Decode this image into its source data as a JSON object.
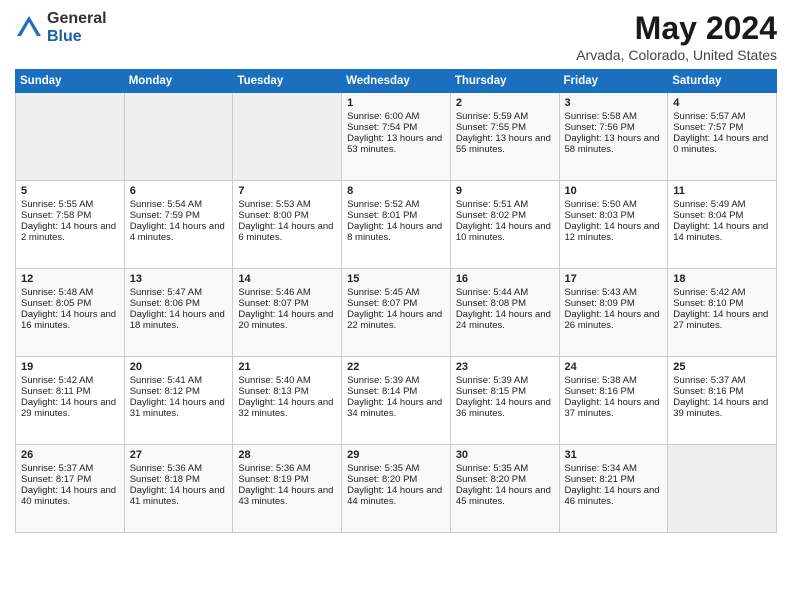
{
  "logo": {
    "general": "General",
    "blue": "Blue"
  },
  "header": {
    "title": "May 2024",
    "subtitle": "Arvada, Colorado, United States"
  },
  "days_of_week": [
    "Sunday",
    "Monday",
    "Tuesday",
    "Wednesday",
    "Thursday",
    "Friday",
    "Saturday"
  ],
  "weeks": [
    [
      {
        "day": "",
        "sunrise": "",
        "sunset": "",
        "daylight": "",
        "empty": true
      },
      {
        "day": "",
        "sunrise": "",
        "sunset": "",
        "daylight": "",
        "empty": true
      },
      {
        "day": "",
        "sunrise": "",
        "sunset": "",
        "daylight": "",
        "empty": true
      },
      {
        "day": "1",
        "sunrise": "Sunrise: 6:00 AM",
        "sunset": "Sunset: 7:54 PM",
        "daylight": "Daylight: 13 hours and 53 minutes.",
        "empty": false
      },
      {
        "day": "2",
        "sunrise": "Sunrise: 5:59 AM",
        "sunset": "Sunset: 7:55 PM",
        "daylight": "Daylight: 13 hours and 55 minutes.",
        "empty": false
      },
      {
        "day": "3",
        "sunrise": "Sunrise: 5:58 AM",
        "sunset": "Sunset: 7:56 PM",
        "daylight": "Daylight: 13 hours and 58 minutes.",
        "empty": false
      },
      {
        "day": "4",
        "sunrise": "Sunrise: 5:57 AM",
        "sunset": "Sunset: 7:57 PM",
        "daylight": "Daylight: 14 hours and 0 minutes.",
        "empty": false
      }
    ],
    [
      {
        "day": "5",
        "sunrise": "Sunrise: 5:55 AM",
        "sunset": "Sunset: 7:58 PM",
        "daylight": "Daylight: 14 hours and 2 minutes.",
        "empty": false
      },
      {
        "day": "6",
        "sunrise": "Sunrise: 5:54 AM",
        "sunset": "Sunset: 7:59 PM",
        "daylight": "Daylight: 14 hours and 4 minutes.",
        "empty": false
      },
      {
        "day": "7",
        "sunrise": "Sunrise: 5:53 AM",
        "sunset": "Sunset: 8:00 PM",
        "daylight": "Daylight: 14 hours and 6 minutes.",
        "empty": false
      },
      {
        "day": "8",
        "sunrise": "Sunrise: 5:52 AM",
        "sunset": "Sunset: 8:01 PM",
        "daylight": "Daylight: 14 hours and 8 minutes.",
        "empty": false
      },
      {
        "day": "9",
        "sunrise": "Sunrise: 5:51 AM",
        "sunset": "Sunset: 8:02 PM",
        "daylight": "Daylight: 14 hours and 10 minutes.",
        "empty": false
      },
      {
        "day": "10",
        "sunrise": "Sunrise: 5:50 AM",
        "sunset": "Sunset: 8:03 PM",
        "daylight": "Daylight: 14 hours and 12 minutes.",
        "empty": false
      },
      {
        "day": "11",
        "sunrise": "Sunrise: 5:49 AM",
        "sunset": "Sunset: 8:04 PM",
        "daylight": "Daylight: 14 hours and 14 minutes.",
        "empty": false
      }
    ],
    [
      {
        "day": "12",
        "sunrise": "Sunrise: 5:48 AM",
        "sunset": "Sunset: 8:05 PM",
        "daylight": "Daylight: 14 hours and 16 minutes.",
        "empty": false
      },
      {
        "day": "13",
        "sunrise": "Sunrise: 5:47 AM",
        "sunset": "Sunset: 8:06 PM",
        "daylight": "Daylight: 14 hours and 18 minutes.",
        "empty": false
      },
      {
        "day": "14",
        "sunrise": "Sunrise: 5:46 AM",
        "sunset": "Sunset: 8:07 PM",
        "daylight": "Daylight: 14 hours and 20 minutes.",
        "empty": false
      },
      {
        "day": "15",
        "sunrise": "Sunrise: 5:45 AM",
        "sunset": "Sunset: 8:07 PM",
        "daylight": "Daylight: 14 hours and 22 minutes.",
        "empty": false
      },
      {
        "day": "16",
        "sunrise": "Sunrise: 5:44 AM",
        "sunset": "Sunset: 8:08 PM",
        "daylight": "Daylight: 14 hours and 24 minutes.",
        "empty": false
      },
      {
        "day": "17",
        "sunrise": "Sunrise: 5:43 AM",
        "sunset": "Sunset: 8:09 PM",
        "daylight": "Daylight: 14 hours and 26 minutes.",
        "empty": false
      },
      {
        "day": "18",
        "sunrise": "Sunrise: 5:42 AM",
        "sunset": "Sunset: 8:10 PM",
        "daylight": "Daylight: 14 hours and 27 minutes.",
        "empty": false
      }
    ],
    [
      {
        "day": "19",
        "sunrise": "Sunrise: 5:42 AM",
        "sunset": "Sunset: 8:11 PM",
        "daylight": "Daylight: 14 hours and 29 minutes.",
        "empty": false
      },
      {
        "day": "20",
        "sunrise": "Sunrise: 5:41 AM",
        "sunset": "Sunset: 8:12 PM",
        "daylight": "Daylight: 14 hours and 31 minutes.",
        "empty": false
      },
      {
        "day": "21",
        "sunrise": "Sunrise: 5:40 AM",
        "sunset": "Sunset: 8:13 PM",
        "daylight": "Daylight: 14 hours and 32 minutes.",
        "empty": false
      },
      {
        "day": "22",
        "sunrise": "Sunrise: 5:39 AM",
        "sunset": "Sunset: 8:14 PM",
        "daylight": "Daylight: 14 hours and 34 minutes.",
        "empty": false
      },
      {
        "day": "23",
        "sunrise": "Sunrise: 5:39 AM",
        "sunset": "Sunset: 8:15 PM",
        "daylight": "Daylight: 14 hours and 36 minutes.",
        "empty": false
      },
      {
        "day": "24",
        "sunrise": "Sunrise: 5:38 AM",
        "sunset": "Sunset: 8:16 PM",
        "daylight": "Daylight: 14 hours and 37 minutes.",
        "empty": false
      },
      {
        "day": "25",
        "sunrise": "Sunrise: 5:37 AM",
        "sunset": "Sunset: 8:16 PM",
        "daylight": "Daylight: 14 hours and 39 minutes.",
        "empty": false
      }
    ],
    [
      {
        "day": "26",
        "sunrise": "Sunrise: 5:37 AM",
        "sunset": "Sunset: 8:17 PM",
        "daylight": "Daylight: 14 hours and 40 minutes.",
        "empty": false
      },
      {
        "day": "27",
        "sunrise": "Sunrise: 5:36 AM",
        "sunset": "Sunset: 8:18 PM",
        "daylight": "Daylight: 14 hours and 41 minutes.",
        "empty": false
      },
      {
        "day": "28",
        "sunrise": "Sunrise: 5:36 AM",
        "sunset": "Sunset: 8:19 PM",
        "daylight": "Daylight: 14 hours and 43 minutes.",
        "empty": false
      },
      {
        "day": "29",
        "sunrise": "Sunrise: 5:35 AM",
        "sunset": "Sunset: 8:20 PM",
        "daylight": "Daylight: 14 hours and 44 minutes.",
        "empty": false
      },
      {
        "day": "30",
        "sunrise": "Sunrise: 5:35 AM",
        "sunset": "Sunset: 8:20 PM",
        "daylight": "Daylight: 14 hours and 45 minutes.",
        "empty": false
      },
      {
        "day": "31",
        "sunrise": "Sunrise: 5:34 AM",
        "sunset": "Sunset: 8:21 PM",
        "daylight": "Daylight: 14 hours and 46 minutes.",
        "empty": false
      },
      {
        "day": "",
        "sunrise": "",
        "sunset": "",
        "daylight": "",
        "empty": true
      }
    ]
  ]
}
